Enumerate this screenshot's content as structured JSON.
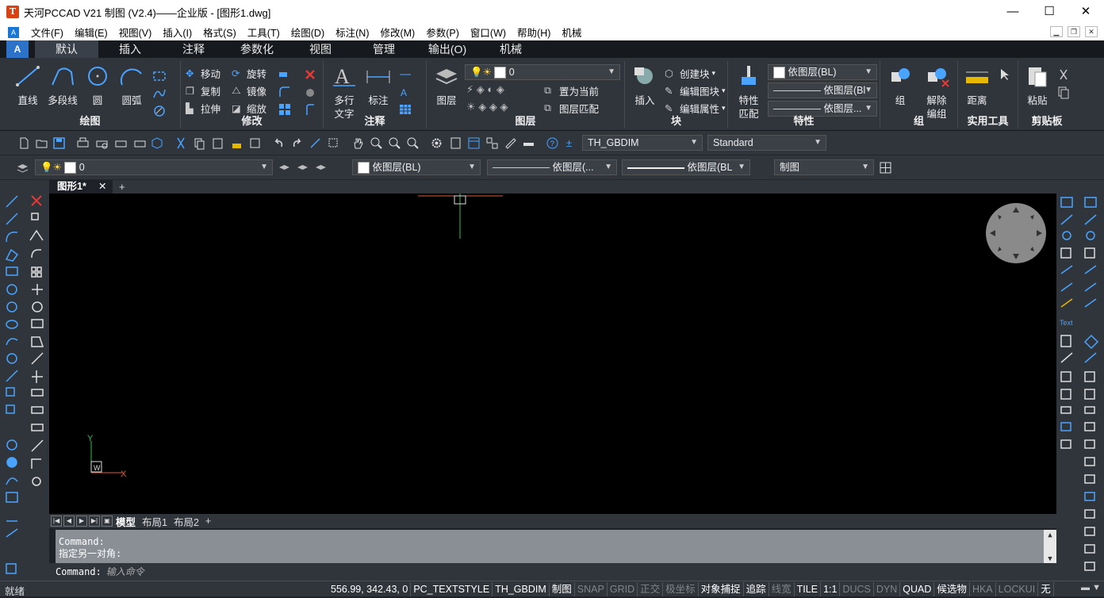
{
  "window": {
    "title": "天河PCCAD V21 制图 (V2.4)——企业版 - [图形1.dwg]",
    "app_icon": "T",
    "minimize": "—",
    "maximize": "☐",
    "close": "✕"
  },
  "menubar": {
    "items": [
      "文件(F)",
      "编辑(E)",
      "视图(V)",
      "插入(I)",
      "格式(S)",
      "工具(T)",
      "绘图(D)",
      "标注(N)",
      "修改(M)",
      "参数(P)",
      "窗口(W)",
      "帮助(H)",
      "机械"
    ]
  },
  "ribbon_tabs": [
    "默认",
    "插入",
    "注释",
    "参数化",
    "视图",
    "管理",
    "输出(O)",
    "机械"
  ],
  "ribbon": {
    "draw": {
      "title": "绘图",
      "line": "直线",
      "polyline": "多段线",
      "circle": "圆",
      "arc": "圆弧"
    },
    "modify": {
      "title": "修改",
      "move": "移动",
      "rotate": "旋转",
      "copy": "复制",
      "mirror": "镜像",
      "stretch": "拉伸",
      "scale": "缩放"
    },
    "annotation": {
      "title": "注释",
      "mtext": "多行\n文字",
      "mtext_l1": "多行",
      "mtext_l2": "文字",
      "dim": "标注"
    },
    "layers": {
      "title": "图层",
      "layer_btn": "图层",
      "layer_value": "0",
      "set_current": "置为当前",
      "match_layer": "图层匹配"
    },
    "block": {
      "title": "块",
      "insert": "插入",
      "create": "创建块",
      "edit": "编辑图块",
      "attr": "编辑属性"
    },
    "properties": {
      "title": "特性",
      "match_l1": "特性",
      "match_l2": "匹配",
      "color": "依图层(BL)",
      "linetype": "依图层(Bl",
      "lineweight": "依图层..."
    },
    "groups": {
      "title": "组",
      "group": "组",
      "ungroup_l1": "解除",
      "ungroup_l2": "编组"
    },
    "utilities": {
      "title": "实用工具",
      "measure": "距离"
    },
    "clipboard": {
      "title": "剪贴板",
      "paste": "粘贴"
    }
  },
  "toolbar1": {
    "dimstyle": "TH_GBDIM",
    "textstyle": "Standard"
  },
  "toolbar2": {
    "layer": "0",
    "color": "依图层(BL)",
    "linetype": "依图层(...",
    "lineweight": "依图层(BL",
    "plotstyle": "制图"
  },
  "doc_tabs": {
    "active": "图形1*",
    "close": "✕",
    "add": "+"
  },
  "canvas": {
    "ucs_y": "Y",
    "ucs_x": "X",
    "ucs_w": "W"
  },
  "layout_tabs": [
    "模型",
    "布局1",
    "布局2"
  ],
  "layout_add": "+",
  "command": {
    "history": [
      "Command:",
      "指定另一对角:"
    ],
    "prompt": "Command:",
    "placeholder": "输入命令"
  },
  "status": {
    "ready": "就绪",
    "coords": "556.99, 342.43, 0",
    "items": [
      {
        "label": "PC_TEXTSTYLE",
        "state": "on"
      },
      {
        "label": "TH_GBDIM",
        "state": "on"
      },
      {
        "label": "制图",
        "state": "on"
      },
      {
        "label": "SNAP",
        "state": "off"
      },
      {
        "label": "GRID",
        "state": "off"
      },
      {
        "label": "正交",
        "state": "off"
      },
      {
        "label": "极坐标",
        "state": "off"
      },
      {
        "label": "对象捕捉",
        "state": "on"
      },
      {
        "label": "追踪",
        "state": "on"
      },
      {
        "label": "线宽",
        "state": "off"
      },
      {
        "label": "TILE",
        "state": "on"
      },
      {
        "label": "1:1",
        "state": "on"
      },
      {
        "label": "DUCS",
        "state": "off"
      },
      {
        "label": "DYN",
        "state": "off"
      },
      {
        "label": "QUAD",
        "state": "on"
      },
      {
        "label": "候选物",
        "state": "on"
      },
      {
        "label": "HKA",
        "state": "off"
      },
      {
        "label": "LOCKUI",
        "state": "off"
      },
      {
        "label": "无",
        "state": "on"
      }
    ]
  },
  "colors": {
    "accent": "#2b72c8",
    "canvas": "#000000",
    "panel": "#30353c",
    "cross_x": "#e05a3a",
    "cross_y": "#2fc04a"
  }
}
